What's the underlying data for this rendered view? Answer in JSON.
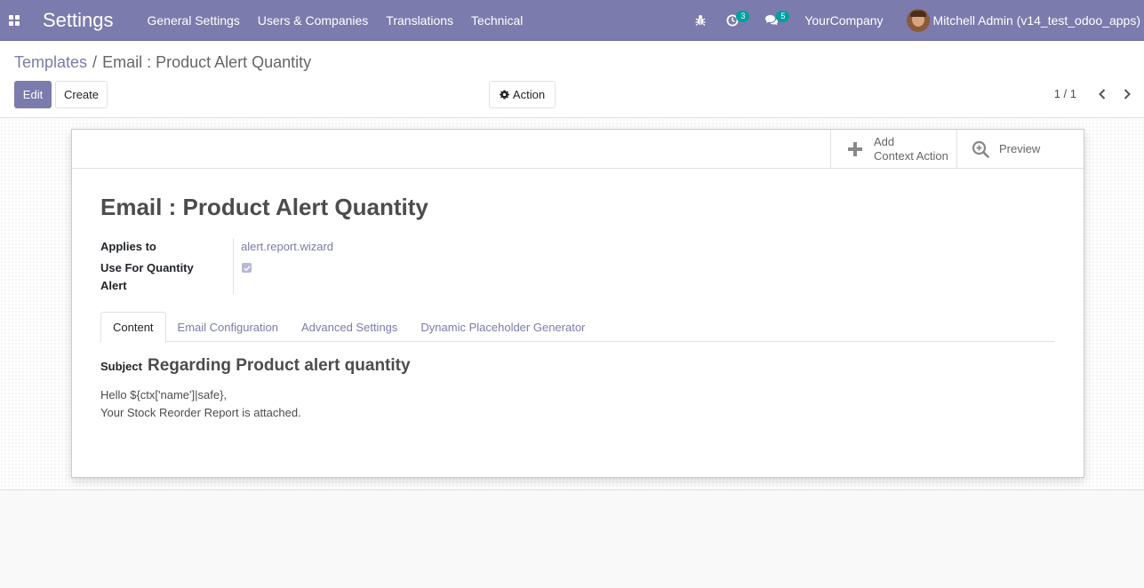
{
  "navbar": {
    "app_title": "Settings",
    "menu": [
      {
        "label": "General Settings"
      },
      {
        "label": "Users & Companies"
      },
      {
        "label": "Translations"
      },
      {
        "label": "Technical"
      }
    ],
    "activities_badge": "3",
    "messages_badge": "5",
    "company": "YourCompany",
    "user": "Mitchell Admin (v14_test_odoo_apps)",
    "accent_color": "#7c7bad",
    "badge_color": "#00a09d"
  },
  "breadcrumb": {
    "parent": "Templates",
    "separator": "/",
    "current": "Email : Product Alert Quantity"
  },
  "toolbar": {
    "edit_label": "Edit",
    "create_label": "Create",
    "action_label": "Action",
    "pager_text": "1 / 1"
  },
  "button_box": {
    "add_context_line1": "Add",
    "add_context_line2": "Context Action",
    "preview_label": "Preview"
  },
  "record": {
    "title": "Email : Product Alert Quantity",
    "applies_to_label": "Applies to",
    "applies_to_value": "alert.report.wizard",
    "quantity_alert_label_line1": "Use For Quantity",
    "quantity_alert_label_line2": "Alert",
    "quantity_alert_checked": true
  },
  "tabs": [
    {
      "label": "Content",
      "active": true
    },
    {
      "label": "Email Configuration",
      "active": false
    },
    {
      "label": "Advanced Settings",
      "active": false
    },
    {
      "label": "Dynamic Placeholder Generator",
      "active": false
    }
  ],
  "content": {
    "subject_label": "Subject",
    "subject_value": "Regarding Product alert quantity",
    "body_line1": "Hello ${ctx['name']|safe},",
    "body_line2": "Your Stock Reorder Report is attached."
  }
}
